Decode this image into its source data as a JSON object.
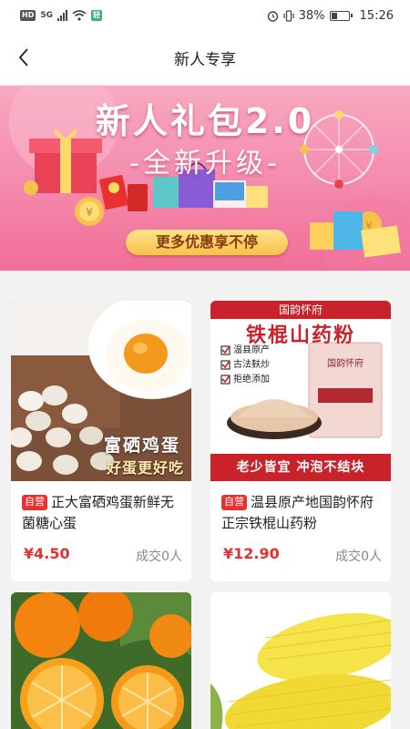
{
  "status_bar": {
    "left_chips": [
      "HD",
      "5G",
      "轻"
    ],
    "battery": "38%",
    "time": "15:26"
  },
  "header": {
    "back_icon": "chevron-left-icon",
    "title": "新人专享"
  },
  "banner": {
    "title": "新人礼包2.0",
    "subtitle": "-全新升级-",
    "button_label": "更多优惠享不停",
    "colors": {
      "top": "#f7a9bf",
      "bottom": "#f06e98",
      "pill": "#f7c24a"
    }
  },
  "products": [
    {
      "image": {
        "lines": [
          "富硒鸡蛋",
          "好蛋更好吃"
        ]
      },
      "tag": "自营",
      "title": "正大富硒鸡蛋新鲜无菌糖心蛋",
      "price": "¥4.50",
      "sold": "成交0人"
    },
    {
      "image": {
        "brand": "国韵怀府",
        "headline": "铁棍山药粉",
        "features": [
          "温县原产",
          "古法麸炒",
          "拒绝添加"
        ],
        "package_brand": "国韵怀府",
        "footer": "老少皆宜 冲泡不结块"
      },
      "tag": "自营",
      "title": "温县原产地国韵怀府正宗铁棍山药粉",
      "price": "¥12.90",
      "sold": "成交0人"
    },
    {
      "image": {
        "subject": "orange-photo"
      }
    },
    {
      "image": {
        "subject": "corn-photo"
      }
    }
  ],
  "accent_color": "#e8312f"
}
